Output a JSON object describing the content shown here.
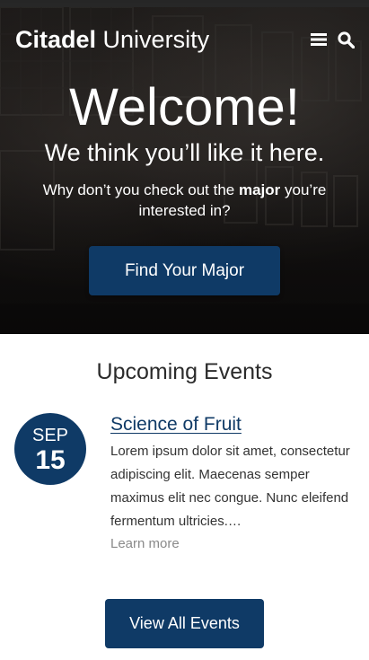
{
  "header": {
    "brand_bold": "Citadel",
    "brand_light": "University",
    "menu_icon": "hamburger-icon",
    "search_icon": "search-icon"
  },
  "hero": {
    "heading": "Welcome!",
    "tagline": "We think you’ll like it here.",
    "sub_before": "Why don’t you check out the ",
    "sub_bold": "major",
    "sub_after": " you’re interested in?",
    "cta_label": "Find Your Major"
  },
  "events": {
    "section_title": "Upcoming Events",
    "items": [
      {
        "month": "SEP",
        "day": "15",
        "title": "Science of Fruit",
        "description": "Lorem ipsum dolor sit amet, consectetur adipiscing elit. Maecenas semper maximus elit nec congue. Nunc eleifend fermentum ultricies.…",
        "link_label": "Learn more"
      }
    ],
    "view_all_label": "View All Events"
  },
  "colors": {
    "accent": "#0f3a66",
    "text": "#333333",
    "muted": "#8a8a8a"
  }
}
